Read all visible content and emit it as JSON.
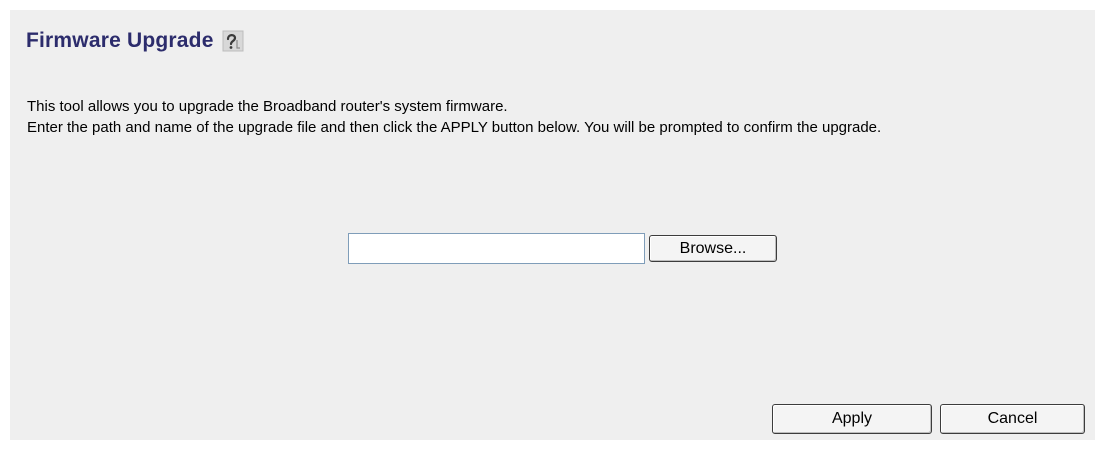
{
  "page": {
    "title": "Firmware Upgrade",
    "help_icon": "help-icon"
  },
  "description": {
    "line1": "This tool allows you to upgrade the Broadband router's system firmware.",
    "line2": "Enter the path and name of the upgrade file and then click the APPLY button below. You will be prompted to confirm the upgrade."
  },
  "upload": {
    "file_value": "",
    "browse_label": "Browse..."
  },
  "actions": {
    "apply_label": "Apply",
    "cancel_label": "Cancel"
  },
  "colors": {
    "title": "#2c2c6c",
    "panel_background": "#efefef",
    "input_border": "#7f9db9"
  }
}
